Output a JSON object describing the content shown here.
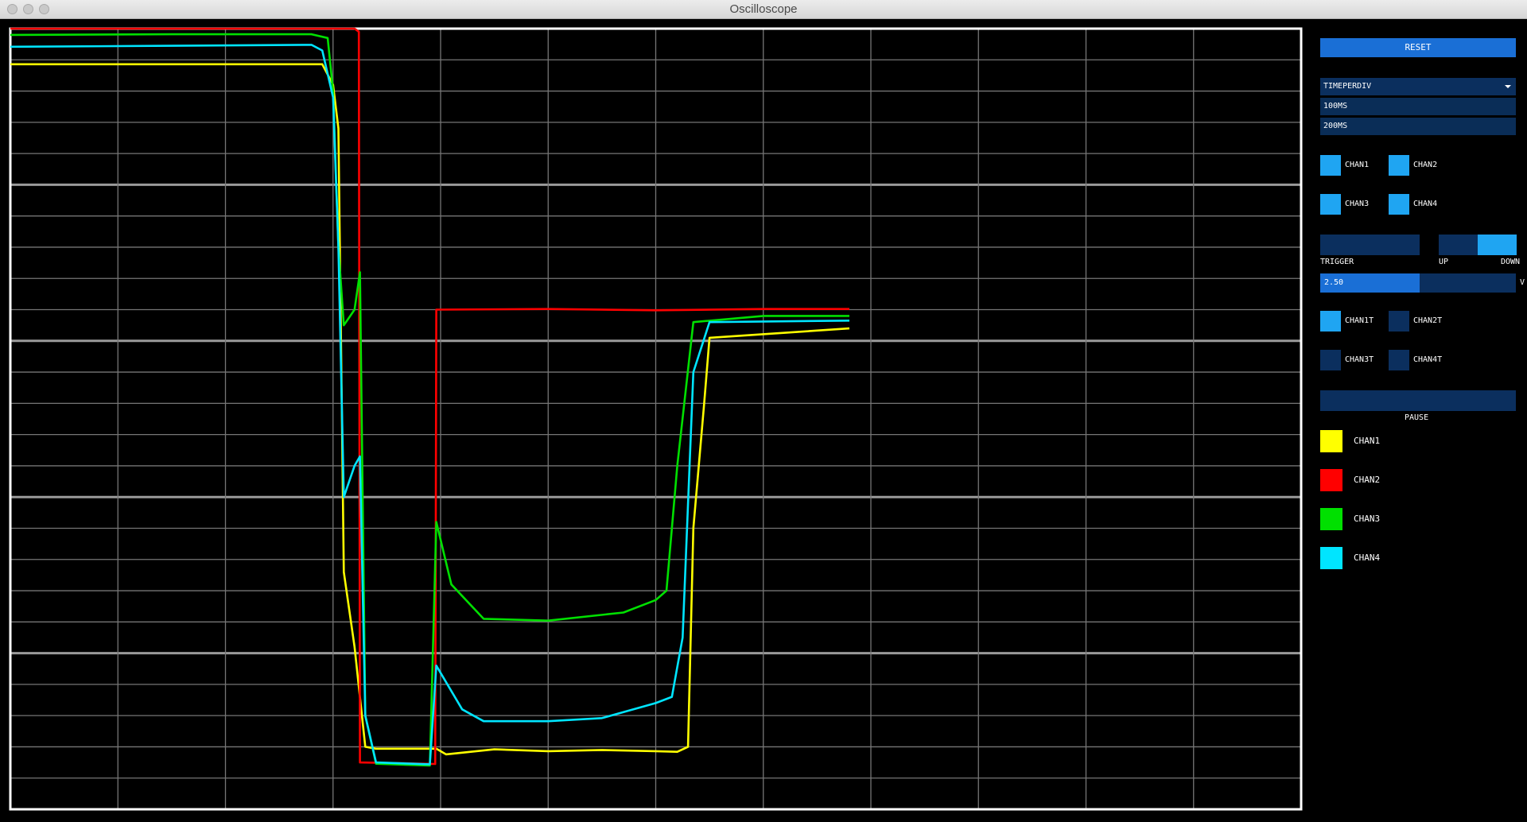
{
  "window": {
    "title": "Oscilloscope"
  },
  "controls": {
    "reset_label": "RESET",
    "timediv": {
      "label": "TIMEPERDIV",
      "options": [
        "100MS",
        "200MS"
      ]
    },
    "channels": [
      "CHAN1",
      "CHAN2",
      "CHAN3",
      "CHAN4"
    ],
    "channel_enabled": [
      true,
      true,
      true,
      true
    ],
    "trigger": {
      "label": "TRIGGER",
      "up_label": "UP",
      "down_label": "DOWN",
      "direction": "DOWN"
    },
    "level": {
      "value": "2.50",
      "unit": "V",
      "fill_fraction": 0.41
    },
    "trigger_channels": [
      "CHAN1T",
      "CHAN2T",
      "CHAN3T",
      "CHAN4T"
    ],
    "trigger_channel_selected": [
      true,
      false,
      false,
      false
    ],
    "pause_label": "PAUSE"
  },
  "legend": [
    {
      "label": "CHAN1",
      "color": "#ffff00"
    },
    {
      "label": "CHAN2",
      "color": "#ff0000"
    },
    {
      "label": "CHAN3",
      "color": "#00e000"
    },
    {
      "label": "CHAN4",
      "color": "#00e5ff"
    }
  ],
  "chart_data": {
    "type": "line",
    "grid": true,
    "major_divisions": {
      "x": 12,
      "y": 5
    },
    "minor_divisions_y": 25,
    "xlim": [
      0,
      12
    ],
    "ylim": [
      0,
      25
    ],
    "series": [
      {
        "name": "CHAN1",
        "color": "#ffff00",
        "points": [
          [
            0,
            23.86
          ],
          [
            1.5,
            23.86
          ],
          [
            2.9,
            23.86
          ],
          [
            3.0,
            23.2
          ],
          [
            3.05,
            21.8
          ],
          [
            3.1,
            7.6
          ],
          [
            3.2,
            5.2
          ],
          [
            3.3,
            2.0
          ],
          [
            3.4,
            1.94
          ],
          [
            3.9,
            1.94
          ],
          [
            3.96,
            1.94
          ],
          [
            4.05,
            1.76
          ],
          [
            4.5,
            1.92
          ],
          [
            5.0,
            1.86
          ],
          [
            5.5,
            1.9
          ],
          [
            6.0,
            1.86
          ],
          [
            6.2,
            1.84
          ],
          [
            6.3,
            2.0
          ],
          [
            6.35,
            9.0
          ],
          [
            6.45,
            13.0
          ],
          [
            6.5,
            15.1
          ],
          [
            7.8,
            15.4
          ]
        ]
      },
      {
        "name": "CHAN2",
        "color": "#ff0000",
        "points": [
          [
            0,
            25.0
          ],
          [
            3.2,
            25.0
          ],
          [
            3.24,
            24.9
          ],
          [
            3.25,
            1.5
          ],
          [
            3.95,
            1.45
          ],
          [
            3.96,
            16.0
          ],
          [
            5.0,
            16.02
          ],
          [
            6.0,
            15.98
          ],
          [
            7.0,
            16.02
          ],
          [
            7.8,
            16.02
          ]
        ]
      },
      {
        "name": "CHAN3",
        "color": "#00e000",
        "points": [
          [
            0,
            24.8
          ],
          [
            1.5,
            24.82
          ],
          [
            2.8,
            24.82
          ],
          [
            2.95,
            24.7
          ],
          [
            3.0,
            23.0
          ],
          [
            3.05,
            18.0
          ],
          [
            3.1,
            15.5
          ],
          [
            3.2,
            16.0
          ],
          [
            3.25,
            17.2
          ],
          [
            3.3,
            3.0
          ],
          [
            3.4,
            1.46
          ],
          [
            3.9,
            1.4
          ],
          [
            3.96,
            9.2
          ],
          [
            4.1,
            7.2
          ],
          [
            4.4,
            6.1
          ],
          [
            5.0,
            6.04
          ],
          [
            5.7,
            6.3
          ],
          [
            6.0,
            6.7
          ],
          [
            6.1,
            7.0
          ],
          [
            6.2,
            11.0
          ],
          [
            6.35,
            15.6
          ],
          [
            7.0,
            15.8
          ],
          [
            7.8,
            15.8
          ]
        ]
      },
      {
        "name": "CHAN4",
        "color": "#00e5ff",
        "points": [
          [
            0,
            24.42
          ],
          [
            1.5,
            24.45
          ],
          [
            2.8,
            24.48
          ],
          [
            2.9,
            24.3
          ],
          [
            3.0,
            22.8
          ],
          [
            3.05,
            18.0
          ],
          [
            3.1,
            10.0
          ],
          [
            3.2,
            11.0
          ],
          [
            3.25,
            11.3
          ],
          [
            3.3,
            3.0
          ],
          [
            3.4,
            1.5
          ],
          [
            3.9,
            1.44
          ],
          [
            3.96,
            4.6
          ],
          [
            4.2,
            3.2
          ],
          [
            4.4,
            2.82
          ],
          [
            5.0,
            2.82
          ],
          [
            5.5,
            2.92
          ],
          [
            6.0,
            3.4
          ],
          [
            6.15,
            3.6
          ],
          [
            6.25,
            5.5
          ],
          [
            6.35,
            14.0
          ],
          [
            6.5,
            15.6
          ],
          [
            7.8,
            15.65
          ]
        ]
      }
    ]
  }
}
